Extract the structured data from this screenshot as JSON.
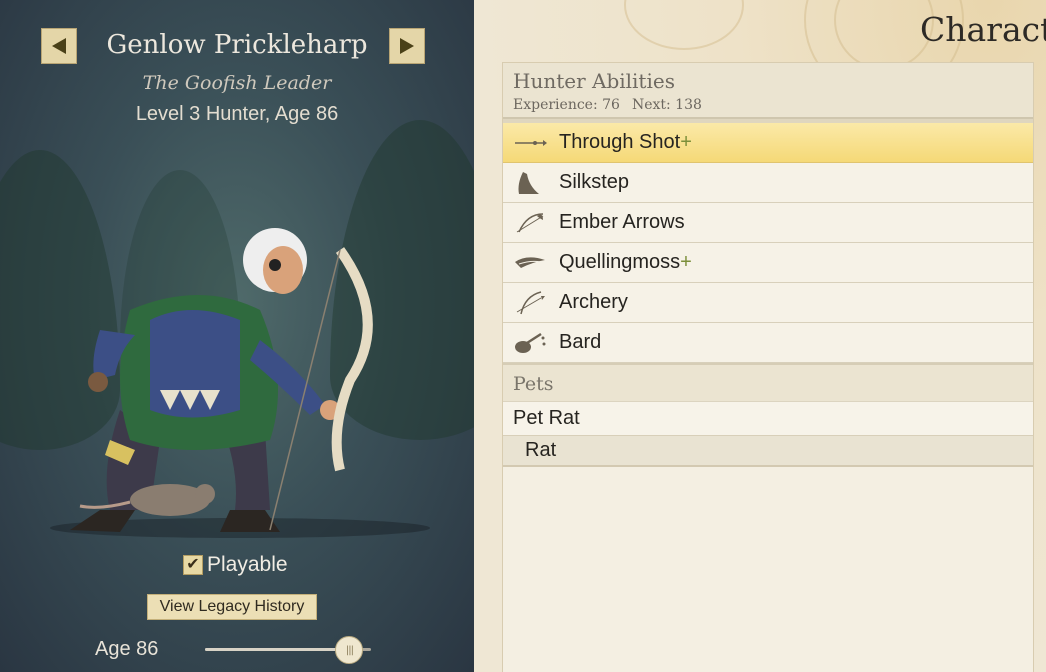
{
  "character": {
    "name": "Genlow Prickleharp",
    "title": "The Goofish Leader",
    "level_line": "Level 3 Hunter, Age 86",
    "playable_label": "Playable",
    "playable_checked": true,
    "legacy_button": "View Legacy History",
    "age_label": "Age 86",
    "age_slider_fraction": 0.87
  },
  "sheet": {
    "title": "Characte",
    "abilities": {
      "heading": "Hunter Abilities",
      "experience": "Experience: 76",
      "next": "Next: 138",
      "items": [
        {
          "label": "Through Shot",
          "plus": "+",
          "icon": "arrow-shot-icon",
          "selected": true
        },
        {
          "label": "Silkstep",
          "plus": "",
          "icon": "cloak-icon",
          "selected": false
        },
        {
          "label": "Ember Arrows",
          "plus": "",
          "icon": "fire-bow-icon",
          "selected": false
        },
        {
          "label": "Quellingmoss",
          "plus": "+",
          "icon": "moss-icon",
          "selected": false
        },
        {
          "label": "Archery",
          "plus": "",
          "icon": "bow-icon",
          "selected": false
        },
        {
          "label": "Bard",
          "plus": "",
          "icon": "lute-icon",
          "selected": false
        }
      ]
    },
    "pets": {
      "heading": "Pets",
      "pet_name": "Pet Rat",
      "pet_type": "Rat"
    }
  },
  "colors": {
    "selected_row": "#f5d977",
    "plus": "#7c8f3a",
    "left_panel": "#3a4f57",
    "nav_button": "#e4d6a8"
  }
}
